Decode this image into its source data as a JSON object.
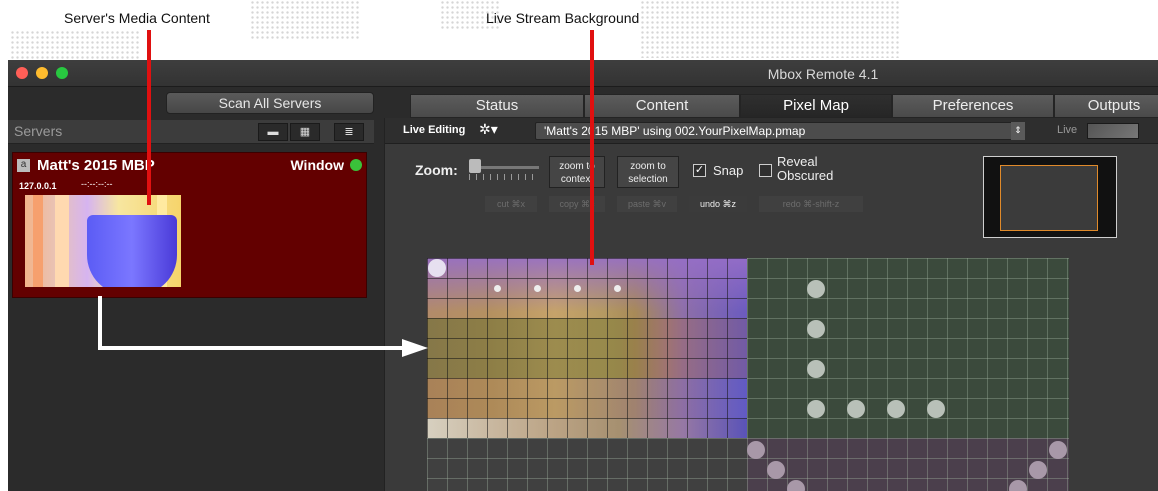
{
  "annotations": {
    "left": "Server's Media Content",
    "right": "Live Stream Background"
  },
  "window": {
    "title": "Mbox Remote 4.1",
    "traffic_light_colors": [
      "#ff5f57",
      "#febc2e",
      "#28c840"
    ]
  },
  "sidebar": {
    "scan_button": "Scan All Servers",
    "header": "Servers",
    "view_icons": [
      "list-large-icon",
      "grid-icon",
      "list-small-icon"
    ],
    "server": {
      "badge": "a",
      "name": "Matt's 2015 MBP",
      "ip": "127.0.0.1",
      "timecode": "--:--:--:--",
      "mode": "Window",
      "status_color": "#3ac23a"
    }
  },
  "tabs": [
    {
      "label": "Status",
      "active": false
    },
    {
      "label": "Content",
      "active": false
    },
    {
      "label": "Pixel Map",
      "active": true
    },
    {
      "label": "Preferences",
      "active": false
    },
    {
      "label": "Outputs",
      "active": false
    }
  ],
  "toolbar": {
    "live_editing": "Live Editing",
    "pixelmap_select": "'Matt's 2015 MBP' using 002.YourPixelMap.pmap",
    "live_label": "Live"
  },
  "zoom": {
    "label": "Zoom:",
    "zoom_to_context": "zoom to context",
    "zoom_to_selection": "zoom to selection",
    "snap_label": "Snap",
    "snap_checked": true,
    "reveal_label": "Reveal Obscured",
    "reveal_checked": false
  },
  "edit_buttons": {
    "cut": "cut ⌘x",
    "copy": "copy ⌘c",
    "paste": "paste ⌘v",
    "undo": "undo ⌘z",
    "redo": "redo ⌘-shift-z"
  }
}
